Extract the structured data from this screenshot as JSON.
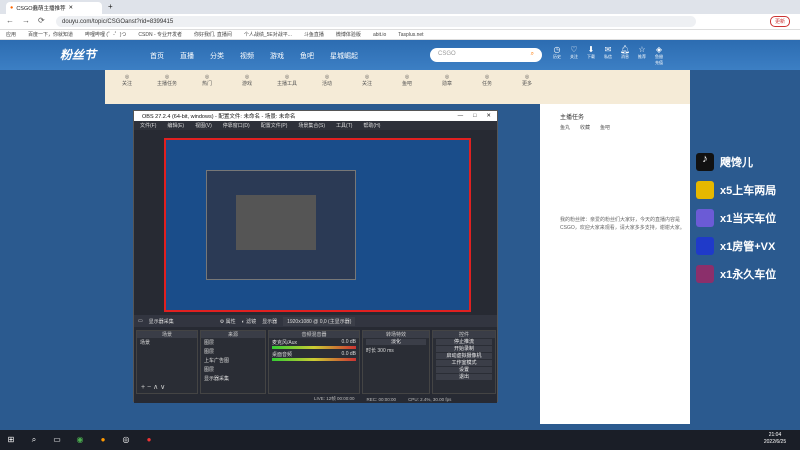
{
  "browser": {
    "tab_title": "CSGO蠢萌主播推荐",
    "url": "douyu.com/topic/CSGOanst?rid=8399415",
    "update_label": "更新",
    "bookmarks": [
      "应用",
      "百度一下，你就知道",
      "哔哩哔哩 (゜-゜)つ",
      "CSDN - 专业开发者",
      "你好我们, 直播间",
      "个人战绩_5E对战平...",
      "斗鱼直播",
      "微博体验版",
      "abit.io",
      "Tasplus.net"
    ]
  },
  "douyu": {
    "logo": "粉丝节",
    "nav": [
      "首页",
      "直播",
      "分类",
      "视频",
      "游戏",
      "鱼吧",
      "星城崛起"
    ],
    "search_placeholder": "CSGO",
    "user_icons": [
      "历史",
      "关注",
      "下载",
      "私信",
      "消息",
      "推荐",
      "鱼翅充值"
    ],
    "categories": [
      "关注",
      "主播任务",
      "热门",
      "游戏",
      "主播工具",
      "活动",
      "关注",
      "鱼吧",
      "勋章",
      "任务",
      "更多"
    ],
    "right": {
      "title": "主播任务",
      "tabs": [
        "鱼丸",
        "收藏",
        "鱼吧"
      ],
      "desc": "我的粉丝牌：亲爱的粉丝们大家好，今天的直播内容是CSGO，欢迎大家来观看，请大家多多支持，谢谢大家。"
    }
  },
  "obs": {
    "title": "OBS 27.2.4 (64-bit, windows) - 配置文件: 未命名 - 场景: 未命名",
    "menu": [
      "文件(F)",
      "编辑(E)",
      "视图(V)",
      "停靠窗口(D)",
      "配置文件(P)",
      "场景集合(S)",
      "工具(T)",
      "帮助(H)"
    ],
    "bar": [
      "显示器采集",
      "属性",
      "滤镜",
      "显示器",
      "1920x1080 @ 0,0 (主显示器)"
    ],
    "panels": {
      "scenes": "场景",
      "sources": "来源",
      "mixer": "音频混音器",
      "transitions": "转场特效",
      "controls": "控件"
    },
    "scene_item": "场景",
    "sources_list": [
      "图层",
      "图层",
      "上车广告图",
      "图层",
      "显示器采集"
    ],
    "mixer": [
      {
        "name": "麦克风/Aux",
        "db": "0.0 dB"
      },
      {
        "name": "桌面音频",
        "db": "0.0 dB"
      }
    ],
    "transition": "淡化",
    "duration_label": "时长",
    "duration": "300 ms",
    "controls": [
      "停止推流",
      "开始录制",
      "启动虚拟摄像机",
      "工作室模式",
      "设置",
      "退出"
    ],
    "status": [
      "LIVE: 12帧 00:00:00",
      "REC: 00:00:00",
      "CPU: 2.4%, 30.00 fps"
    ]
  },
  "overlay": [
    {
      "text": "飕馋儿",
      "color": "#111111"
    },
    {
      "text": "x5上车两局",
      "color": "#e6b800"
    },
    {
      "text": "x1当天车位",
      "color": "#6b5bd6"
    },
    {
      "text": "x1房管+VX",
      "color": "#1f3ac9"
    },
    {
      "text": "x1永久车位",
      "color": "#8b2f6b"
    }
  ],
  "taskbar": {
    "time": "21:04",
    "date": "2022/6/25"
  }
}
